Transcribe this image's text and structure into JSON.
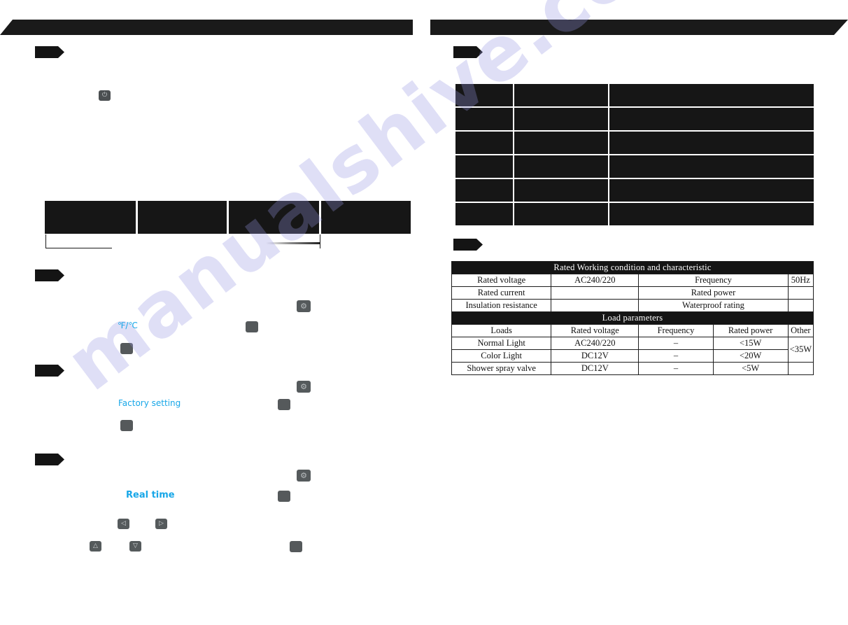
{
  "document": {
    "type": "scanned-manual-page",
    "watermark": "manualshive.com"
  },
  "left_column": {
    "header_bar": {
      "label": ""
    },
    "sections": [
      {
        "id": "section-1",
        "tag_label": ""
      },
      {
        "id": "section-2",
        "tag_label": ""
      },
      {
        "id": "section-3",
        "tag_label": ""
      },
      {
        "id": "section-4",
        "tag_label": ""
      }
    ],
    "labels": {
      "unit_toggle": "℉/℃",
      "factory_setting": "Factory setting",
      "real_time": "Real time"
    },
    "keys": {
      "power": "power-key",
      "gear": "⚙",
      "left_arrow": "◁",
      "right_arrow": "▷",
      "up_arrow": "△",
      "down_arrow": "▽",
      "blank": ""
    },
    "table": {
      "columns": 4,
      "cells": [
        "",
        "",
        "",
        ""
      ]
    }
  },
  "right_column": {
    "header_bar": {
      "label": ""
    },
    "sections": [
      {
        "id": "section-r1",
        "tag_label": ""
      },
      {
        "id": "section-r2",
        "tag_label": ""
      }
    ],
    "parameter_table": {
      "rows": 6,
      "columns": 3
    },
    "spec_table": {
      "title_working": "Rated Working condition and characteristic",
      "rows_working": [
        [
          "Rated voltage",
          "AC240/220",
          "Frequency",
          "50Hz"
        ],
        [
          "Rated current",
          "",
          "Rated power",
          ""
        ],
        [
          "Insulation resistance",
          "",
          "Waterproof rating",
          ""
        ]
      ],
      "title_load": "Load parameters",
      "load_headers": [
        "Loads",
        "Rated voltage",
        "Frequency",
        "Rated power",
        "Other"
      ],
      "load_rows": [
        [
          "Normal Light",
          "AC240/220",
          "–",
          "<15W"
        ],
        [
          "Color Light",
          "DC12V",
          "–",
          "<20W"
        ],
        [
          "Shower spray valve",
          "DC12V",
          "–",
          "<5W"
        ]
      ],
      "other_value": "<35W"
    }
  },
  "colors": {
    "ink": "#161616",
    "accent_cyan": "#18a7e8",
    "key_gray": "#555a5c",
    "watermark": "#9696e1"
  }
}
